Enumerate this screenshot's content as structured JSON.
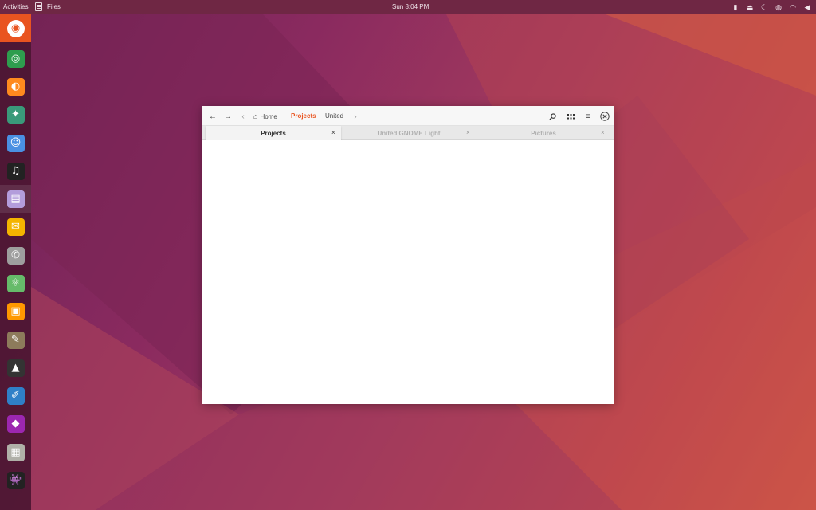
{
  "topbar": {
    "activities": "Activities",
    "app_menu": "Files",
    "clock": "Sun  8:04 PM",
    "tray_icons": [
      "battery-icon",
      "eject-icon",
      "weather-icon",
      "globe-icon",
      "wifi-icon",
      "volume-icon"
    ]
  },
  "dock": {
    "items": [
      {
        "name": "ubuntu-logo-icon",
        "glyph": "◉",
        "color": "#e95420"
      },
      {
        "name": "chrome-icon",
        "glyph": "◎",
        "color": "#2e9d4e"
      },
      {
        "name": "firefox-icon",
        "glyph": "◐",
        "color": "#ff8a1e"
      },
      {
        "name": "safari-compass-icon",
        "glyph": "✦",
        "color": "#3a9a7a"
      },
      {
        "name": "messenger-icon",
        "glyph": "☺",
        "color": "#4a90e2"
      },
      {
        "name": "music-icon",
        "glyph": "♫",
        "color": "#222222"
      },
      {
        "name": "files-icon",
        "glyph": "▤",
        "color": "#b39ddb"
      },
      {
        "name": "mail-icon",
        "glyph": "✉",
        "color": "#f4b400"
      },
      {
        "name": "phone-icon",
        "glyph": "✆",
        "color": "#9e9e9e"
      },
      {
        "name": "atom-icon",
        "glyph": "⚛",
        "color": "#66bb6a"
      },
      {
        "name": "package-icon",
        "glyph": "▣",
        "color": "#ff9800"
      },
      {
        "name": "gimp-icon",
        "glyph": "✎",
        "color": "#8d7b5b"
      },
      {
        "name": "inkscape-icon",
        "glyph": "▲",
        "color": "#333333"
      },
      {
        "name": "sketch-icon",
        "glyph": "✐",
        "color": "#2f80c8"
      },
      {
        "name": "color-picker-icon",
        "glyph": "◆",
        "color": "#9c27b0"
      },
      {
        "name": "calculator-icon",
        "glyph": "▦",
        "color": "#b0b0a8"
      },
      {
        "name": "game-invader-icon",
        "glyph": "👾",
        "color": "#222222"
      }
    ]
  },
  "window": {
    "nav": {
      "back_icon": "←",
      "forward_icon": "→",
      "left_chevron": "‹",
      "right_chevron": "›"
    },
    "breadcrumb": {
      "home": "Home",
      "current": "Projects",
      "next": "United"
    },
    "tabs": [
      {
        "label": "Projects",
        "close": "×"
      },
      {
        "label": "United GNOME Light",
        "close": "×"
      },
      {
        "label": "Pictures",
        "close": "×"
      }
    ],
    "toolbar": {
      "search_icon": "⌕",
      "grid_icon": "⠿",
      "menu_icon": "≡",
      "close_icon": "⊗"
    }
  },
  "colors": {
    "accent": "#e95420",
    "topbar": "#6f2744",
    "dock": "#4a1630"
  }
}
